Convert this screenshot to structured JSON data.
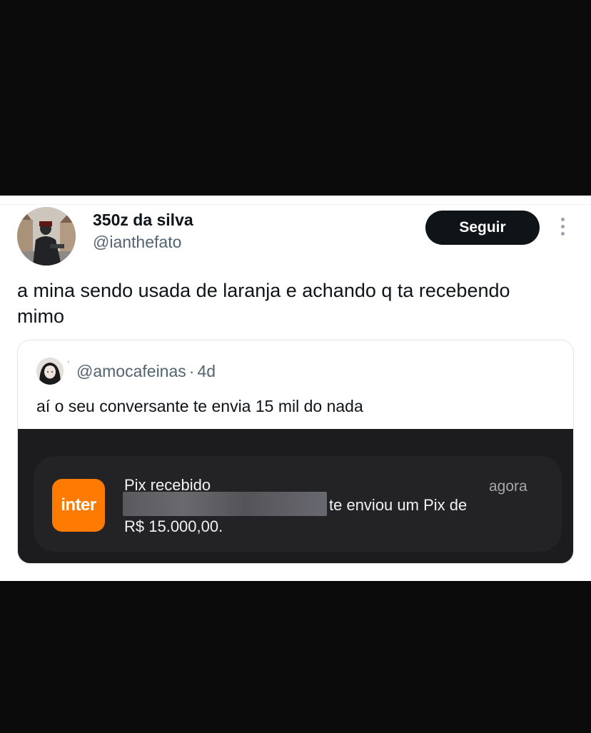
{
  "tweet": {
    "display_name": "350z da silva",
    "handle": "@ianthefato",
    "follow_label": "Seguir",
    "text": "a mina sendo usada de laranja e achando q ta recebendo mimo",
    "avatar_icon": "user-avatar-photo",
    "more_icon": "more-vertical-icon"
  },
  "quote": {
    "handle": "@amocafeinas",
    "separator": "·",
    "age": "4d",
    "text": "aí o seu conversante te envia 15 mil do nada"
  },
  "notification": {
    "app_label": "inter",
    "title": "Pix recebido",
    "time": "agora",
    "body": "te enviou um Pix de",
    "amount": "R$ 15.000,00.",
    "colors": {
      "app_icon": "#ff7a00",
      "card": "#232325",
      "background": "#1c1c1e"
    }
  },
  "colors": {
    "follow_button": "#0f1419",
    "handle": "#536471"
  }
}
